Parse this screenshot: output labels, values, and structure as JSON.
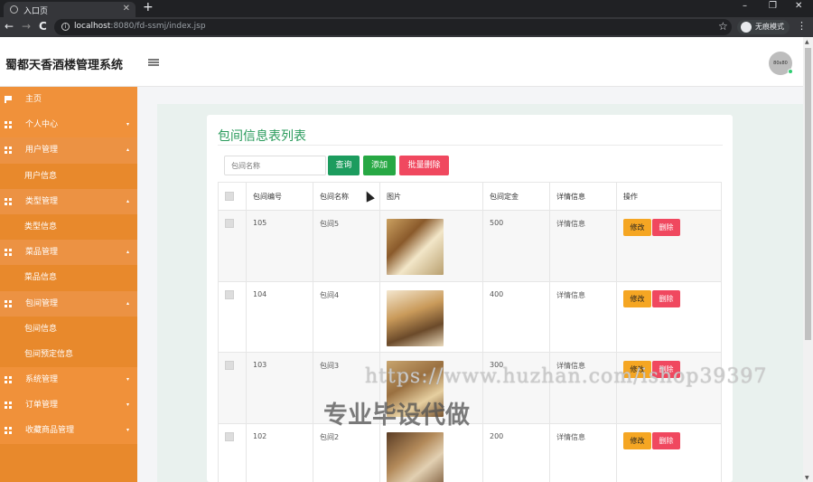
{
  "browser": {
    "tab_title": "入口页",
    "tab_close": "✕",
    "new_tab": "+",
    "url_host": "localhost",
    "url_path": ":8080/fd-ssmj/index.jsp",
    "incognito_label": "无痕模式",
    "win_minimize": "–",
    "win_restore": "❐",
    "win_close": "✕",
    "back": "←",
    "forward": "→",
    "reload": "C",
    "star": "☆",
    "menu": "⋮"
  },
  "header": {
    "app_title": "蜀都天香酒楼管理系统",
    "avatar_text": "80x80"
  },
  "sidebar": {
    "items": [
      {
        "label": "主页",
        "type": "main",
        "icon": "flag-icon"
      },
      {
        "label": "个人中心",
        "type": "group",
        "icon": "grid-icon",
        "caret": "▾"
      },
      {
        "label": "用户管理",
        "type": "group-active",
        "icon": "grid-icon",
        "caret": "▴"
      },
      {
        "label": "用户信息",
        "type": "sub"
      },
      {
        "label": "类型管理",
        "type": "group-active",
        "icon": "grid-icon",
        "caret": "▴"
      },
      {
        "label": "类型信息",
        "type": "sub"
      },
      {
        "label": "菜品管理",
        "type": "group-active",
        "icon": "grid-icon",
        "caret": "▴"
      },
      {
        "label": "菜品信息",
        "type": "sub"
      },
      {
        "label": "包间管理",
        "type": "group-active",
        "icon": "grid-icon",
        "caret": "▴"
      },
      {
        "label": "包间信息",
        "type": "sub"
      },
      {
        "label": "包间预定信息",
        "type": "sub"
      },
      {
        "label": "系统管理",
        "type": "group",
        "icon": "grid-icon",
        "caret": "▾"
      },
      {
        "label": "订单管理",
        "type": "group",
        "icon": "grid-icon",
        "caret": "▾"
      },
      {
        "label": "收藏商品管理",
        "type": "group",
        "icon": "grid-icon",
        "caret": "▾"
      }
    ]
  },
  "panel": {
    "title": "包间信息表列表",
    "search_placeholder": "包间名称",
    "btn_query": "查询",
    "btn_add": "添加",
    "btn_bulk_delete": "批量删除"
  },
  "table": {
    "headers": [
      "包间编号",
      "包间名称",
      "图片",
      "包间定金",
      "详情信息",
      "操作"
    ],
    "rows": [
      {
        "id": "105",
        "name": "包间5",
        "deposit": "500",
        "detail": "详情信息"
      },
      {
        "id": "104",
        "name": "包间4",
        "deposit": "400",
        "detail": "详情信息"
      },
      {
        "id": "103",
        "name": "包间3",
        "deposit": "300",
        "detail": "详情信息"
      },
      {
        "id": "102",
        "name": "包间2",
        "deposit": "200",
        "detail": "详情信息"
      }
    ],
    "edit_label": "修改",
    "delete_label": "删除"
  },
  "watermark": {
    "url": "https://www.huzhan.com/ishop39397",
    "text": "专业毕设代做"
  },
  "colors": {
    "sidebar": "#e8892c",
    "accent_green": "#2a9b5c",
    "danger": "#f0485f",
    "warning": "#f5a623"
  }
}
